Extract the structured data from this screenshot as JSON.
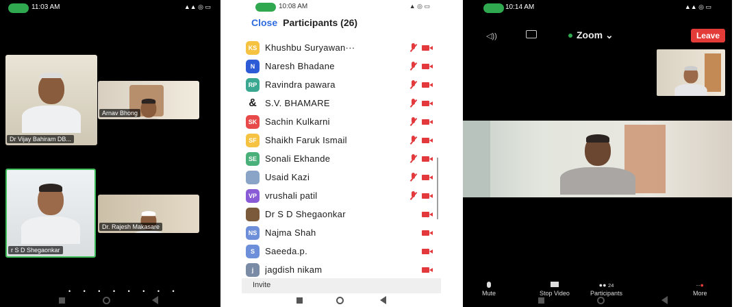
{
  "screens": [
    {
      "status_time": "11:03 AM",
      "tiles": [
        {
          "name": "Dr Vijay Bahiram DB..."
        },
        {
          "name": "Arnav Bhong"
        },
        {
          "name": "r S D Shegaonkar"
        },
        {
          "name": "Dr. Rajesh Makasare"
        }
      ],
      "page_dots": "• • • • • • • •"
    },
    {
      "status_time": "10:08 AM",
      "close_label": "Close",
      "title": "Participants (26)",
      "participants": [
        {
          "initials": "KS",
          "color": "#f5c242",
          "name": "Khushbu Suryawan···",
          "muted": true,
          "video_off": true
        },
        {
          "initials": "N",
          "color": "#2d5bd6",
          "name": "Naresh Bhadane",
          "muted": true,
          "video_off": true
        },
        {
          "initials": "RP",
          "color": "#3aa890",
          "name": "Ravindra pawara",
          "muted": true,
          "video_off": true
        },
        {
          "initials": "&",
          "color": "#ffffff",
          "name": "S.V. BHAMARE",
          "muted": true,
          "video_off": true
        },
        {
          "initials": "SK",
          "color": "#e84a4a",
          "name": "Sachin Kulkarni",
          "muted": true,
          "video_off": true
        },
        {
          "initials": "SF",
          "color": "#f5c242",
          "name": "Shaikh Faruk Ismail",
          "muted": true,
          "video_off": true
        },
        {
          "initials": "SE",
          "color": "#49b07a",
          "name": "Sonali Ekhande",
          "muted": true,
          "video_off": true
        },
        {
          "initials": "",
          "color": "#8aa4c8",
          "name": "Usaid Kazi",
          "muted": true,
          "video_off": true
        },
        {
          "initials": "VP",
          "color": "#8a5bd6",
          "name": "vrushali patil",
          "muted": true,
          "video_off": true
        },
        {
          "initials": "",
          "color": "#7a5a3a",
          "name": "Dr S D Shegaonkar",
          "muted": false,
          "video_off": true
        },
        {
          "initials": "NS",
          "color": "#6d8ed8",
          "name": "Najma Shah",
          "muted": false,
          "video_off": true
        },
        {
          "initials": "S",
          "color": "#6d8ed8",
          "name": "Saeeda.p.",
          "muted": false,
          "video_off": true
        },
        {
          "initials": "j",
          "color": "#7a8ba5",
          "name": "jagdish nikam",
          "muted": false,
          "video_off": true
        }
      ],
      "invite_label": "Invite"
    },
    {
      "status_time": "10:14 AM",
      "app_label": "Zoom",
      "leave_label": "Leave",
      "controls": [
        {
          "label": "Mute"
        },
        {
          "label": "Stop Video"
        },
        {
          "label": "Participants",
          "badge": "24"
        },
        {
          "label": "More"
        }
      ]
    }
  ],
  "colors": {
    "zoom_blue": "#2d6bdf",
    "leave_red": "#e33b37",
    "muted_red": "#e3393c",
    "active_green": "#2fa84f"
  }
}
